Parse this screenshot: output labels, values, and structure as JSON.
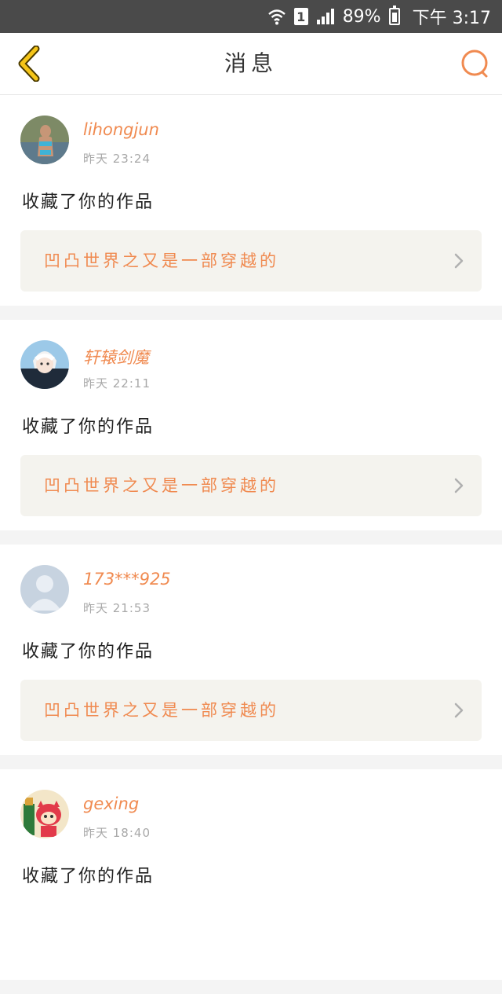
{
  "status_bar": {
    "battery_percent": "89%",
    "sim_slot": "1",
    "time": "下午 3:17"
  },
  "header": {
    "title": "消息"
  },
  "messages": [
    {
      "username": "lihongjun",
      "time": "昨天 23:24",
      "action": "收藏了你的作品",
      "work_title": "凹凸世界之又是一部穿越的"
    },
    {
      "username": "轩辕剑魔",
      "time": "昨天 22:11",
      "action": "收藏了你的作品",
      "work_title": "凹凸世界之又是一部穿越的"
    },
    {
      "username": "173***925",
      "time": "昨天 21:53",
      "action": "收藏了你的作品",
      "work_title": "凹凸世界之又是一部穿越的"
    },
    {
      "username": "gexing",
      "time": "昨天 18:40",
      "action": "收藏了你的作品",
      "work_title": ""
    }
  ],
  "colors": {
    "accent": "#f08a50",
    "back_icon": "#f5c518",
    "status_bar_bg": "#4a4a4a",
    "card_inner_bg": "#f4f3ee"
  }
}
